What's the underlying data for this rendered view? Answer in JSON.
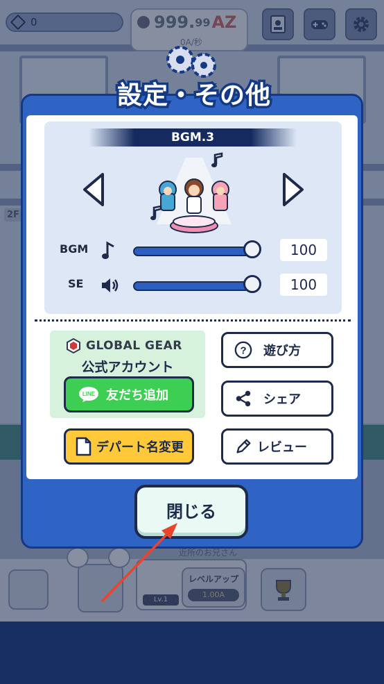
{
  "topbar": {
    "gems": "0",
    "money_value": "999.",
    "money_decimal": "99",
    "money_unit": "AZ",
    "money_rate": "0A/秒"
  },
  "background": {
    "floor_label": "2F",
    "neighbor_name": "近所のお兄さん",
    "level_badge": "Lv.1",
    "levelup_label": "レベルアップ",
    "levelup_cost": "1.00A"
  },
  "dialog": {
    "title": "設定・その他",
    "bgm_track": "BGM.3",
    "bgm_label": "BGM",
    "bgm_value": "100",
    "bgm_level": 1.0,
    "se_label": "SE",
    "se_value": "100",
    "se_level": 1.0,
    "company": "GLOBAL GEAR",
    "official_account": "公式アカウント",
    "add_friend": "友だち追加",
    "line_badge": "LINE",
    "how_to_play": "遊び方",
    "share": "シェア",
    "review": "レビュー",
    "rename_department": "デパート名変更",
    "close": "閉じる"
  },
  "colors": {
    "panel_blue": "#2f63c4",
    "panel_border": "#143a86",
    "line_green": "#3dcf53",
    "rename_yellow": "#ffc93a",
    "close_mint": "#e9faf5",
    "annotation_arrow": "#e8452f"
  },
  "icons": {
    "gear": "gear-icon",
    "left": "arrow-left-icon",
    "right": "arrow-right-icon",
    "note": "music-note-icon",
    "speaker": "speaker-icon",
    "help": "question-icon",
    "share": "share-icon",
    "pencil": "pencil-icon",
    "document": "document-icon",
    "logo": "global-gear-logo-icon"
  }
}
